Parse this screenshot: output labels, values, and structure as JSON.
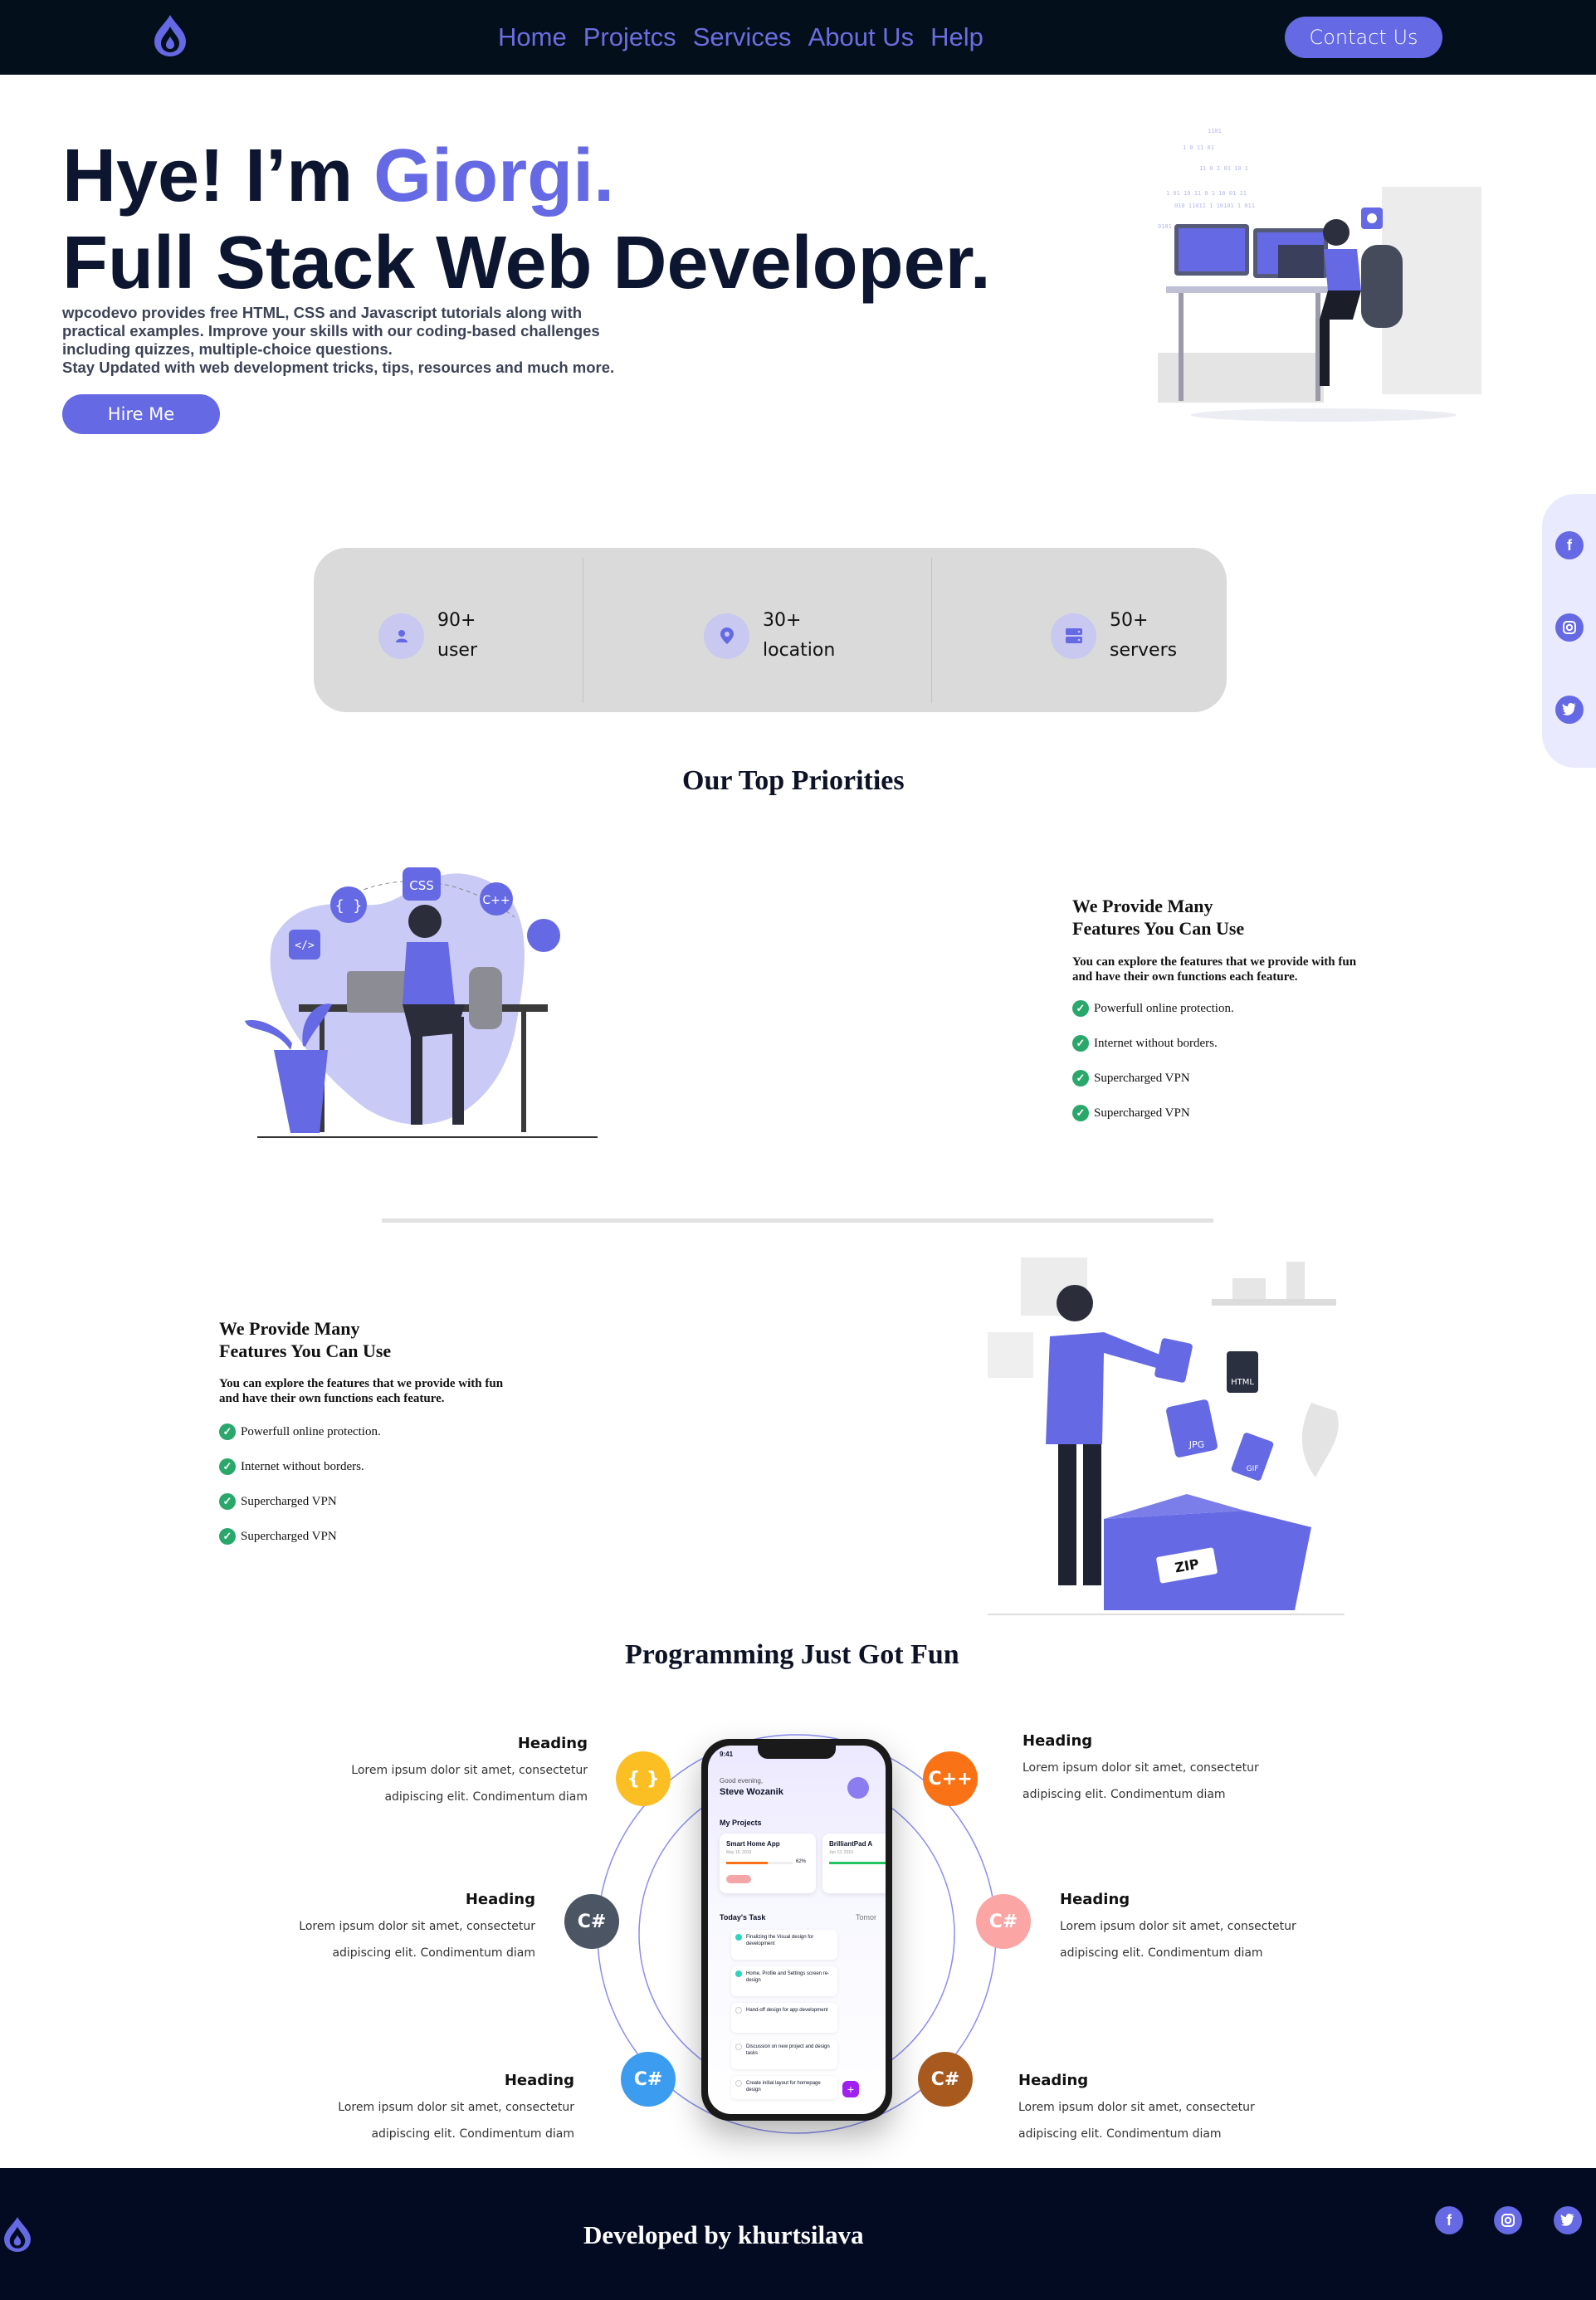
{
  "nav": {
    "logo_icon": "flame-drop-logo",
    "links": [
      "Home",
      "Projetcs",
      "Services",
      "About Us",
      "Help"
    ],
    "contact_label": "Contact Us"
  },
  "hero": {
    "greeting": "Hye! I’m ",
    "name": "Giorgi.",
    "title": "Full Stack Web Developer.",
    "description_lines": [
      "wpcodevo provides free HTML, CSS and Javascript tutorials along with",
      "practical examples. Improve your skills with our coding-based challenges",
      "including quizzes, multiple-choice questions.",
      "Stay Updated with web development tricks, tips, resources and much more."
    ],
    "hire_label": "Hire Me"
  },
  "side_social": [
    "facebook-icon",
    "instagram-icon",
    "twitter-icon"
  ],
  "stats": [
    {
      "icon": "user-icon",
      "value": "90+",
      "label": "user"
    },
    {
      "icon": "location-pin-icon",
      "value": "30+",
      "label": "location"
    },
    {
      "icon": "server-icon",
      "value": "50+",
      "label": "servers"
    }
  ],
  "priorities": {
    "title": "Our Top Priorities",
    "feature_title_1": "We Provide Many",
    "feature_title_2": "Features You Can Use",
    "feature_sub_1": "You can explore the features that we provide with fun",
    "feature_sub_2": "and have their own functions each feature.",
    "items": [
      "Powerfull online protection.",
      "Internet without borders.",
      "Supercharged VPN",
      "Supercharged VPN"
    ],
    "illustration_labels": [
      "CSS",
      "C++",
      "{ }",
      "</>"
    ]
  },
  "features2": {
    "feature_title_1": "We Provide Many",
    "feature_title_2": "Features You Can Use",
    "feature_sub_1": "You can explore the features that we provide with fun",
    "feature_sub_2": "and have their own functions each feature.",
    "items": [
      "Powerfull online protection.",
      "Internet without borders.",
      "Supercharged VPN",
      "Supercharged VPN"
    ],
    "illustration_labels": [
      "HTML",
      "JPG",
      "GIF",
      "ZIP"
    ]
  },
  "programming": {
    "title": "Programming Just Got Fun",
    "cards": [
      {
        "heading": "Heading",
        "line1": "Lorem ipsum dolor sit amet, consectetur",
        "line2": "adipiscing elit. Condimentum diam"
      },
      {
        "heading": "Heading",
        "line1": "Lorem ipsum dolor sit amet, consectetur",
        "line2": "adipiscing elit. Condimentum diam"
      },
      {
        "heading": "Heading",
        "line1": "Lorem ipsum dolor sit amet, consectetur",
        "line2": "adipiscing elit. Condimentum diam"
      },
      {
        "heading": "Heading",
        "line1": "Lorem ipsum dolor sit amet, consectetur",
        "line2": "adipiscing elit. Condimentum diam"
      },
      {
        "heading": "Heading",
        "line1": "Lorem ipsum dolor sit amet, consectetur",
        "line2": "adipiscing elit. Condimentum diam"
      },
      {
        "heading": "Heading",
        "line1": "Lorem ipsum dolor sit amet, consectetur",
        "line2": "adipiscing elit. Condimentum diam"
      }
    ],
    "langs": [
      {
        "label": "{ }",
        "color": "#fbbf24"
      },
      {
        "label": "C++",
        "color": "#f97316"
      },
      {
        "label": "C#",
        "color": "#4b5563"
      },
      {
        "label": "C#",
        "color": "#fca5a5"
      },
      {
        "label": "C#",
        "color": "#3b9cf0"
      },
      {
        "label": "C#",
        "color": "#a85a1e"
      }
    ],
    "phone": {
      "time": "9:41",
      "greeting": "Good evening,",
      "user": "Steve Wozanik",
      "projects_label": "My Projects",
      "project1": "Smart Home App",
      "project1_date": "May 15, 2019",
      "project1_pct": "62%",
      "project2": "BrilliantPad A",
      "project2_date": "Jun 12, 2019",
      "today_label": "Today's Task",
      "tomorrow_label": "Tomor",
      "tasks": [
        "Finalizing the Visual design for development",
        "Home, Profile and Settings screen re-design",
        "Hand-off design for app development",
        "Discussion on new project and design tasks",
        "Create initial layout for homepage design"
      ]
    }
  },
  "footer": {
    "title": "Developed by khurtsilava",
    "social": [
      "facebook-icon",
      "instagram-icon",
      "twitter-icon"
    ]
  }
}
